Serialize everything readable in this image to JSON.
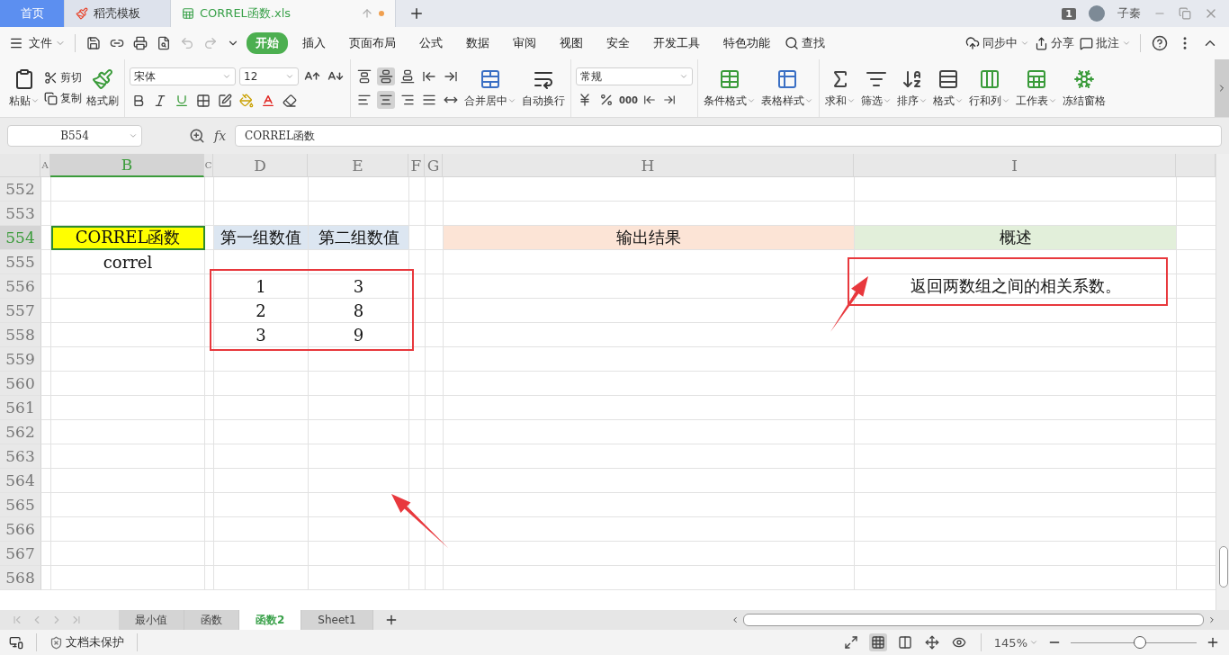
{
  "doc_tabs": [
    {
      "label": "首页",
      "kind": "home",
      "selected": false
    },
    {
      "label": "稻壳模板",
      "kind": "docer",
      "selected": false
    },
    {
      "label": "CORREL函数.xls",
      "kind": "sheet",
      "selected": true
    }
  ],
  "window": {
    "badge": "1",
    "user": "子秦"
  },
  "menu": {
    "file": "文件",
    "tabs": [
      {
        "label": "开始",
        "selected": true
      },
      {
        "label": "插入",
        "selected": false
      },
      {
        "label": "页面布局",
        "selected": false
      },
      {
        "label": "公式",
        "selected": false
      },
      {
        "label": "数据",
        "selected": false
      },
      {
        "label": "审阅",
        "selected": false
      },
      {
        "label": "视图",
        "selected": false
      },
      {
        "label": "安全",
        "selected": false
      },
      {
        "label": "开发工具",
        "selected": false
      },
      {
        "label": "特色功能",
        "selected": false
      }
    ],
    "search": "查找",
    "right": [
      "同步中",
      "分享",
      "批注"
    ]
  },
  "ribbon": {
    "paste": "粘贴",
    "cut": "剪切",
    "copy": "复制",
    "painter": "格式刷",
    "font": "宋体",
    "size": "12",
    "align_buttons": [
      {
        "selected": false
      },
      {
        "selected": true
      },
      {
        "selected": false
      },
      {
        "selected": false
      },
      {
        "selected": false
      },
      {
        "selected": false
      },
      {
        "selected": true
      },
      {
        "selected": false
      },
      {
        "selected": false
      },
      {
        "selected": false
      }
    ],
    "merge": "合并居中",
    "wrap": "自动换行",
    "number_format": "常规",
    "thousands": "000",
    "large": [
      "条件格式",
      "表格样式",
      "求和",
      "筛选",
      "排序",
      "格式",
      "行和列",
      "工作表",
      "冻结窗格"
    ]
  },
  "formula_bar": {
    "name_box": "B554",
    "fx": "fx",
    "formula": "CORREL函数"
  },
  "columns": [
    {
      "label": "A",
      "selected": false
    },
    {
      "label": "B",
      "selected": true
    },
    {
      "label": "C",
      "selected": false
    },
    {
      "label": "D",
      "selected": false
    },
    {
      "label": "E",
      "selected": false
    },
    {
      "label": "F",
      "selected": false
    },
    {
      "label": "G",
      "selected": false
    },
    {
      "label": "H",
      "selected": false
    },
    {
      "label": "I",
      "selected": false
    }
  ],
  "rows": [
    {
      "label": "552",
      "selected": false
    },
    {
      "label": "553",
      "selected": false
    },
    {
      "label": "554",
      "selected": true,
      "cells": {
        "b": {
          "text": "CORREL函数",
          "color": "#ffff00",
          "selected": true
        },
        "d": {
          "text": "第一组数值",
          "color": "#dce6f1",
          "selected": false
        },
        "e": {
          "text": "第二组数值",
          "color": "#dce6f1",
          "selected": false
        },
        "h": {
          "text": "输出结果",
          "color": "#fce4d6",
          "selected": false
        },
        "i": {
          "text": "概述",
          "color": "#e2efda",
          "selected": false
        }
      }
    },
    {
      "label": "555",
      "selected": false,
      "cells": {
        "b": {
          "text": "correl",
          "selected": false
        }
      }
    },
    {
      "label": "556",
      "selected": false,
      "cells": {
        "d": {
          "text": "1",
          "selected": false
        },
        "e": {
          "text": "3",
          "selected": false
        },
        "i": {
          "text": "返回两数组之间的相关系数。",
          "selected": false
        }
      }
    },
    {
      "label": "557",
      "selected": false,
      "cells": {
        "d": {
          "text": "2",
          "selected": false
        },
        "e": {
          "text": "8",
          "selected": false
        }
      }
    },
    {
      "label": "558",
      "selected": false,
      "cells": {
        "d": {
          "text": "3",
          "selected": false
        },
        "e": {
          "text": "9",
          "selected": false
        }
      }
    },
    {
      "label": "559",
      "selected": false
    },
    {
      "label": "560",
      "selected": false
    },
    {
      "label": "561",
      "selected": false
    },
    {
      "label": "562",
      "selected": false
    },
    {
      "label": "563",
      "selected": false
    },
    {
      "label": "564",
      "selected": false
    },
    {
      "label": "565",
      "selected": false
    },
    {
      "label": "566",
      "selected": false
    },
    {
      "label": "567",
      "selected": false
    },
    {
      "label": "568",
      "selected": false
    }
  ],
  "sheets": [
    {
      "label": "最小值",
      "selected": false
    },
    {
      "label": "函数",
      "selected": false
    },
    {
      "label": "函数2",
      "selected": true
    },
    {
      "label": "Sheet1",
      "selected": false
    }
  ],
  "status": {
    "protection": "文档未保护",
    "views": [
      {
        "selected": false
      },
      {
        "selected": true
      },
      {
        "selected": false
      },
      {
        "selected": false
      }
    ],
    "zoom": "145%",
    "level": 0.55
  }
}
